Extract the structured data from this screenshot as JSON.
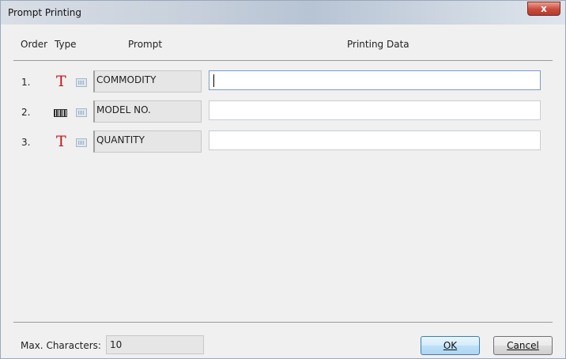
{
  "window": {
    "title": "Prompt Printing",
    "close_glyph": "x"
  },
  "table": {
    "headers": {
      "order": "Order",
      "type": "Type",
      "prompt": "Prompt",
      "data": "Printing Data"
    },
    "rows": [
      {
        "order": "1.",
        "type_icon": "text-type-icon",
        "type_glyph": "T",
        "prompt": "COMMODITY",
        "data": ""
      },
      {
        "order": "2.",
        "type_icon": "barcode-type-icon",
        "type_glyph": "",
        "prompt": "MODEL NO.",
        "data": ""
      },
      {
        "order": "3.",
        "type_icon": "text-type-icon",
        "type_glyph": "T",
        "prompt": "QUANTITY",
        "data": ""
      }
    ]
  },
  "footer": {
    "max_chars_label": "Max. Characters:",
    "max_chars_value": "10",
    "ok_label": "OK",
    "cancel_label": "Cancel"
  },
  "colors": {
    "text_type_icon": "#c0181c",
    "ok_border": "#3c7fb1",
    "close_button": "#c94b3b"
  }
}
